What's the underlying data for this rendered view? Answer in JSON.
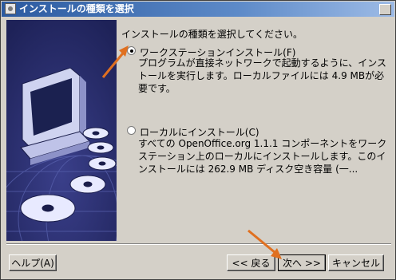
{
  "window": {
    "title": "インストールの種類を選択"
  },
  "heading": "インストールの種類を選択してください。",
  "options": [
    {
      "label": "ワークステーションインストール(F)",
      "selected": true,
      "description": "プログラムが直接ネットワークで起動するように、インストールを実行します。ローカルファイルには 4.9 MBが必要です。"
    },
    {
      "label": "ローカルにインストール(C)",
      "selected": false,
      "description": "すべての OpenOffice.org 1.1.1 コンポーネントをワークステーション上のローカルにインストールします。このインストールには 262.9 MB ディスク空き容量 (一..."
    }
  ],
  "buttons": {
    "help": "ヘルプ(A)",
    "back": "<< 戻る",
    "next": "次へ >>",
    "cancel": "キャンセル"
  },
  "colors": {
    "side_panel": "#2b2f6e",
    "arrow": "#e07020"
  },
  "icons": [
    "computer-monitor-icon",
    "cd-disc-icon",
    "globe-grid-icon",
    "app-window-icon",
    "minimize-icon"
  ]
}
